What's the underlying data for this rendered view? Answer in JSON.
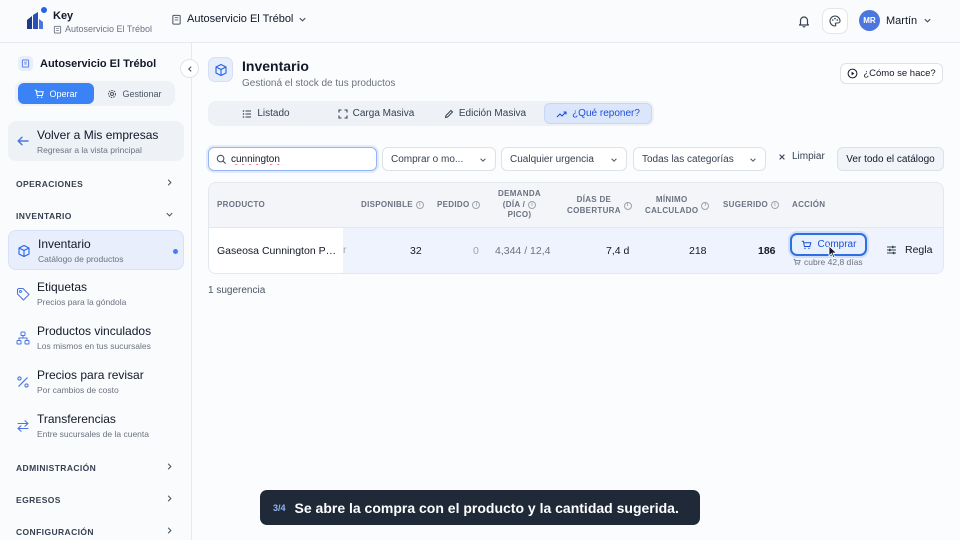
{
  "app": {
    "name": "Key",
    "store_label": "Autoservicio El Trébol",
    "store_switcher": "Autoservicio El Trébol"
  },
  "user": {
    "initials": "MR",
    "name": "Martín"
  },
  "sidebar": {
    "store_name": "Autoservicio El Trébol",
    "mode_operar": "Operar",
    "mode_gestionar": "Gestionar",
    "back": {
      "title": "Volver a Mis empresas",
      "subtitle": "Regresar a la vista principal"
    },
    "sections": {
      "operaciones": "OPERACIONES",
      "inventario": "INVENTARIO",
      "administracion": "ADMINISTRACIÓN",
      "egresos": "EGRESOS",
      "configuracion": "CONFIGURACIÓN"
    },
    "items": [
      {
        "title": "Inventario",
        "subtitle": "Catálogo de productos",
        "icon": "cube-icon"
      },
      {
        "title": "Etiquetas",
        "subtitle": "Precios para la góndola",
        "icon": "tag-icon"
      },
      {
        "title": "Productos vinculados",
        "subtitle": "Los mismos en tus sucursales",
        "icon": "hierarchy-icon"
      },
      {
        "title": "Precios para revisar",
        "subtitle": "Por cambios de costo",
        "icon": "percent-icon"
      },
      {
        "title": "Transferencias",
        "subtitle": "Entre sucursales de la cuenta",
        "icon": "transfer-icon"
      }
    ]
  },
  "page": {
    "title": "Inventario",
    "subtitle": "Gestioná el stock de tus productos",
    "howto": "¿Cómo se hace?"
  },
  "tabs": [
    {
      "label": "Listado",
      "active": false
    },
    {
      "label": "Carga Masiva",
      "active": false
    },
    {
      "label": "Edición Masiva",
      "active": false
    },
    {
      "label": "¿Qué reponer?",
      "active": true
    }
  ],
  "filters": {
    "search_value": "cunnington",
    "mode_select": "Comprar o mo...",
    "urgency_select": "Cualquier urgencia",
    "category_select": "Todas las categorías",
    "clear": "Limpiar",
    "catalog": "Ver todo el catálogo"
  },
  "table": {
    "headers": {
      "producto": "PRODUCTO",
      "disponible": "DISPONIBLE",
      "pedido": "PEDIDO",
      "demanda_1": "DEMANDA",
      "demanda_2": "(DÍA /",
      "demanda_3": "PICO)",
      "dias_1": "DÍAS DE",
      "dias_2": "COBERTURA",
      "minimo_1": "MÍNIMO",
      "minimo_2": "CALCULADO",
      "sugerido": "SUGERIDO",
      "accion": "ACCIÓN"
    },
    "rows": [
      {
        "producto": "Gaseosa Cunnington Po...",
        "trailing": "r",
        "disponible": "32",
        "pedido": "0",
        "demanda": "4,344 / 12,4",
        "dias": "7,4 d",
        "minimo": "218",
        "sugerido": "186",
        "buy_label": "Comprar",
        "cover_note": "cubre 42,8 días",
        "rule_label": "Regla"
      }
    ]
  },
  "results_count": "1 sugerencia",
  "tooltip": {
    "step": "3/4",
    "text": "Se abre la compra con el producto y la cantidad sugerida."
  },
  "colors": {
    "accent": "#3b82f6",
    "tooltip_bg": "#1f2937"
  }
}
